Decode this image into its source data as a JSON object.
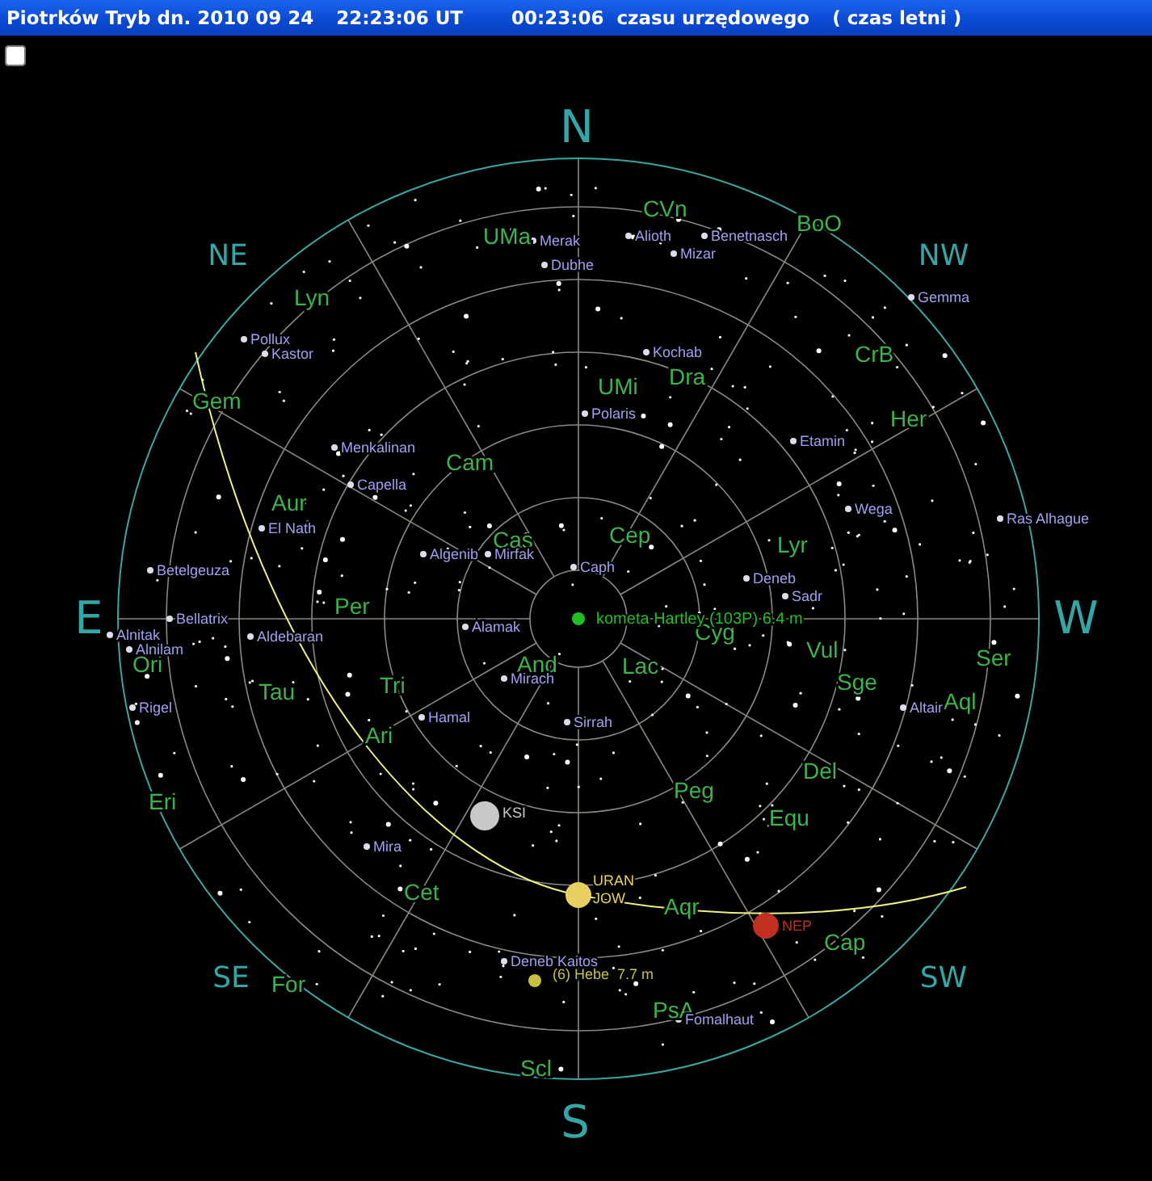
{
  "title_bar": {
    "place_date": "Piotrków Tryb dn. 2010 09 24",
    "ut_time": "22:23:06 UT",
    "local_time": "00:23:06",
    "local_label": "czasu urzędowego",
    "season": "( czas letni )"
  },
  "checkbox": {
    "checked": false
  },
  "sky_map": {
    "compass_points": [
      "N",
      "NE",
      "NW",
      "E",
      "W",
      "SE",
      "SW",
      "S"
    ],
    "constellations": [
      "UMa",
      "CVn",
      "BoO",
      "Lyn",
      "Gem",
      "CrB",
      "Dra",
      "UMi",
      "Her",
      "Cam",
      "Aur",
      "Cas",
      "Cep",
      "Lyr",
      "Per",
      "Cyg",
      "And",
      "Lac",
      "Vul",
      "Ser",
      "Sge",
      "Aql",
      "Ori",
      "Tau",
      "Tri",
      "Ari",
      "Del",
      "Peg",
      "Equ",
      "Eri",
      "Cet",
      "Aqr",
      "Cap",
      "For",
      "PsA",
      "Scl"
    ],
    "stars": [
      "Merak",
      "Dubhe",
      "Alioth",
      "Mizar",
      "Benetnasch",
      "Gemma",
      "Pollux",
      "Kastor",
      "Kochab",
      "Polaris",
      "Etamin",
      "Menkalinan",
      "Capella",
      "Wega",
      "Ras Alhague",
      "El Nath",
      "Algenib",
      "Mirfak",
      "Caph",
      "Betelgeuza",
      "Deneb",
      "Sadr",
      "Bellatrix",
      "Alnitak",
      "Alnilam",
      "Aldebaran",
      "Alamak",
      "Mirach",
      "Rigel",
      "Hamal",
      "Sirrah",
      "Altair",
      "Mira",
      "Deneb Kaitos",
      "Fomalhaut"
    ],
    "objects": [
      {
        "kind": "comet",
        "label": "kometa Hartley (103P) 6.4 m",
        "color": "#20c020"
      },
      {
        "kind": "moon",
        "label": "KSI",
        "color": "#c8c8c8"
      },
      {
        "kind": "planet",
        "label": "URAN",
        "color": "#e8d060"
      },
      {
        "kind": "planet",
        "label": "JOW",
        "color": "#e8d060"
      },
      {
        "kind": "planet",
        "label": "NEP",
        "color": "#c03020"
      },
      {
        "kind": "asteroid",
        "label": "(6) Hebe  7.7 m",
        "color": "#c8c040"
      }
    ]
  }
}
